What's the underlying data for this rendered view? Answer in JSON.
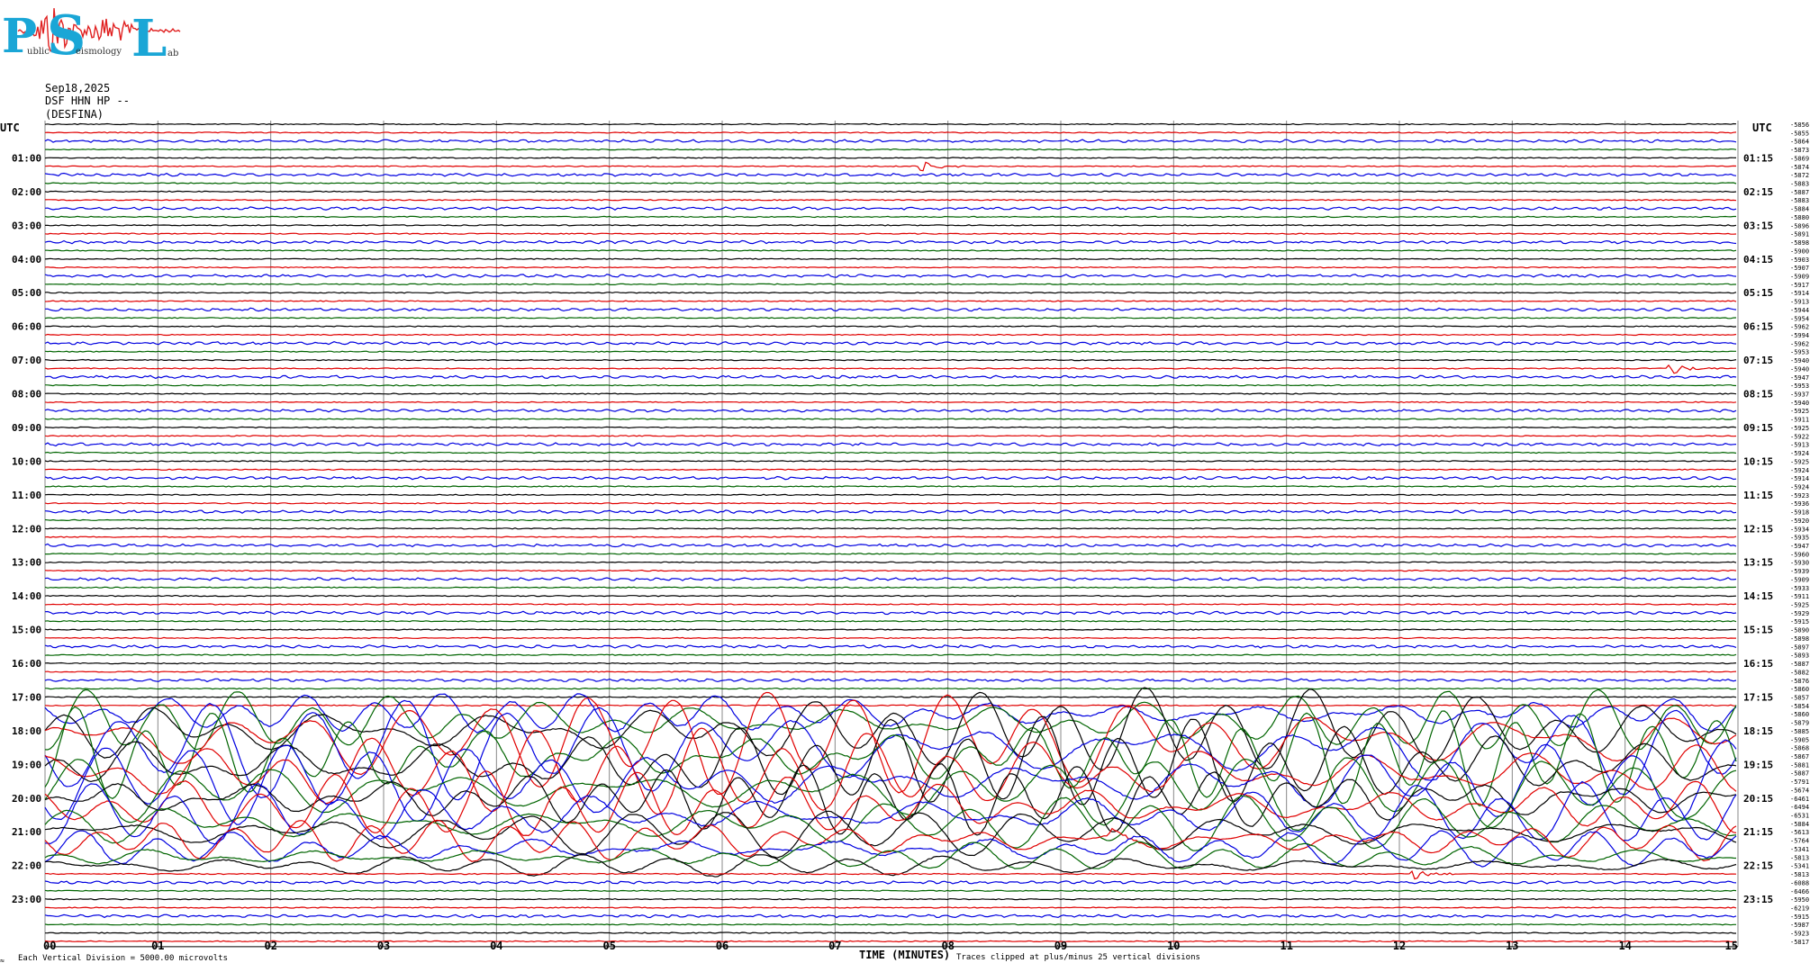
{
  "logo": {
    "letters": [
      "P",
      "S",
      "L"
    ],
    "small_words": [
      "ublic",
      "eismology",
      "ab"
    ]
  },
  "header": {
    "date": "Sep18,2025",
    "channel": "DSF HHN HP --",
    "station": "(DESFINA)"
  },
  "axes": {
    "utc_left": "UTC",
    "utc_right": "UTC",
    "xlabel": "TIME (MINUTES)",
    "vertical_division_note": "Each Vertical Division = 5000.00 microvolts",
    "clip_note": "Traces clipped at plus/minus 25 vertical divisions",
    "corner_mark": "≈"
  },
  "chart_data": {
    "type": "line",
    "title": "Sep18,2025 DSF HHN HP -- (DESFINA)",
    "xlabel": "TIME (MINUTES)",
    "x_range": [
      0,
      15
    ],
    "x_ticks": [
      "00",
      "01",
      "02",
      "03",
      "04",
      "05",
      "06",
      "07",
      "08",
      "09",
      "10",
      "11",
      "12",
      "13",
      "14",
      "15"
    ],
    "trace_minutes": 15,
    "trace_colors": [
      "#000000",
      "#e00000",
      "#0000e0",
      "#006400"
    ],
    "left_labels": [
      "01:00",
      "02:00",
      "03:00",
      "04:00",
      "05:00",
      "06:00",
      "07:00",
      "08:00",
      "09:00",
      "10:00",
      "11:00",
      "12:00",
      "13:00",
      "14:00",
      "15:00",
      "16:00",
      "17:00",
      "18:00",
      "19:00",
      "20:00",
      "21:00",
      "22:00",
      "23:00"
    ],
    "right_labels": [
      "01:15",
      "02:15",
      "03:15",
      "04:15",
      "05:15",
      "06:15",
      "07:15",
      "08:15",
      "09:15",
      "10:15",
      "11:15",
      "12:15",
      "13:15",
      "14:15",
      "15:15",
      "16:15",
      "17:15",
      "18:15",
      "19:15",
      "20:15",
      "21:15",
      "22:15",
      "23:15"
    ],
    "trace_offsets": [
      -5856,
      -5855,
      -5864,
      -5873,
      -5869,
      -5874,
      -5872,
      -5883,
      -5887,
      -5883,
      -5884,
      -5880,
      -5896,
      -5891,
      -5898,
      -5900,
      -5903,
      -5907,
      -5909,
      -5917,
      -5914,
      -5913,
      -5944,
      -5954,
      -5962,
      -5994,
      -5962,
      -5953,
      -5940,
      -5940,
      -5947,
      -5953,
      -5937,
      -5940,
      -5925,
      -5911,
      -5925,
      -5922,
      -5913,
      -5924,
      -5925,
      -5924,
      -5914,
      -5924,
      -5923,
      -5936,
      -5918,
      -5920,
      -5934,
      -5935,
      -5947,
      -5960,
      -5930,
      -5939,
      -5909,
      -5933,
      -5911,
      -5925,
      -5929,
      -5915,
      -5890,
      -5898,
      -5897,
      -5893,
      -5887,
      -5882,
      -5876,
      -5860,
      -5857,
      -5854,
      -5860,
      -5879,
      -5885,
      -5905,
      -5868,
      -5867,
      -5881,
      -5887,
      -5791,
      -5674,
      -6461,
      -6494,
      -6531,
      -5884,
      -5613,
      -5764,
      -5341,
      -5813,
      -5341,
      -5813,
      -6088,
      -6466,
      -5950,
      -6219,
      -5915,
      -5987,
      -5923,
      -5817
    ],
    "events": [
      {
        "trace": 5,
        "minute": 7.75,
        "type": "local event"
      },
      {
        "trace": 29,
        "minute": 14.4,
        "type": "local event"
      },
      {
        "trace": 85,
        "minute": 9.45,
        "type": "local event"
      },
      {
        "trace": 89,
        "minute": 12.1,
        "type": "local event"
      }
    ],
    "teleseism": {
      "first_trace": 70,
      "last_trace": 88,
      "type": "large teleseismic surface waves, clipped at plus/minus 25 vertical divisions"
    }
  }
}
